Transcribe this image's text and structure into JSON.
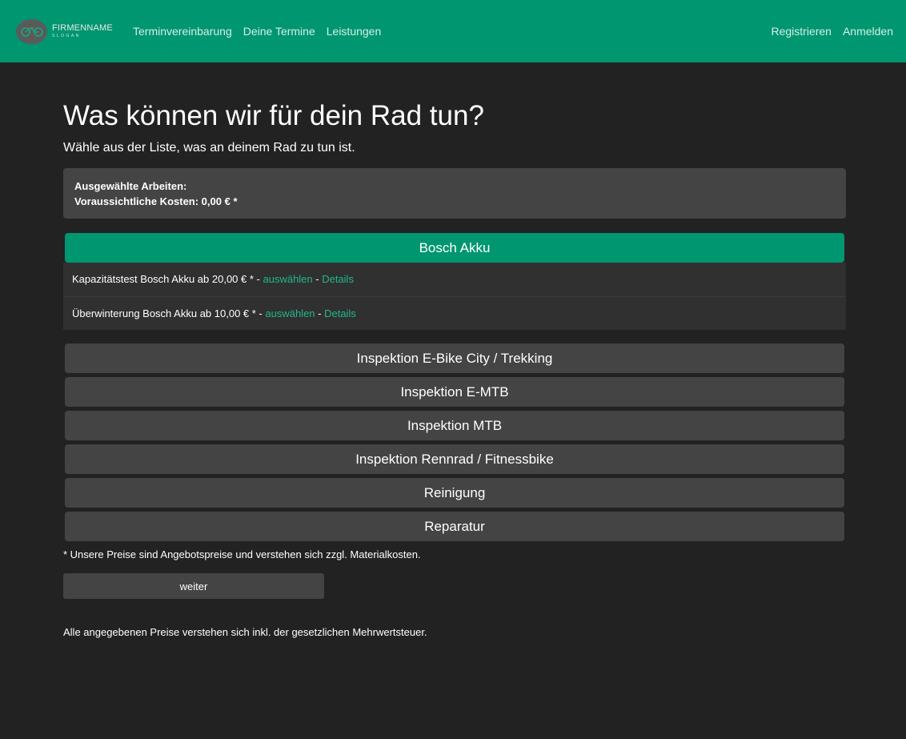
{
  "nav": {
    "brand_name": "FIRMENNAME",
    "brand_slogan": "SLOGAN",
    "links": [
      "Terminvereinbarung",
      "Deine Termine",
      "Leistungen"
    ],
    "right_links": [
      "Registrieren",
      "Anmelden"
    ]
  },
  "main": {
    "title": "Was können wir für dein Rad tun?",
    "subtitle": "Wähle aus der Liste, was an deinem Rad zu tun ist.",
    "summary": {
      "selected_label": "Ausgewählte Arbeiten:",
      "cost_label": "Voraussichtliche Kosten: 0,00 € *"
    },
    "open_category": {
      "title": "Bosch Akku",
      "services": [
        {
          "text": "Kapazitätstest Bosch Akku ab 20,00 € * - ",
          "select": "auswählen",
          "sep": " - ",
          "details": "Details"
        },
        {
          "text": "Überwinterung Bosch Akku ab 10,00 € * - ",
          "select": "auswählen",
          "sep": " - ",
          "details": "Details"
        }
      ]
    },
    "categories": [
      "Inspektion E-Bike City / Trekking",
      "Inspektion E-MTB",
      "Inspektion MTB",
      "Inspektion Rennrad / Fitnessbike",
      "Reinigung",
      "Reparatur"
    ],
    "footnote": "* Unsere Preise sind Angebotspreise und verstehen sich zzgl. Materialkosten.",
    "next_button": "weiter",
    "vat_note": "Alle angegebenen Preise verstehen sich inkl. der gesetzlichen Mehrwertsteuer."
  },
  "colors": {
    "brand": "#009670",
    "background": "#222222",
    "panel": "#444444",
    "link": "#20b88c"
  }
}
